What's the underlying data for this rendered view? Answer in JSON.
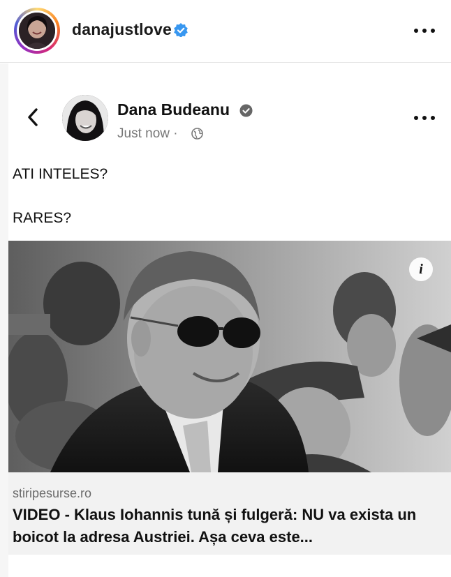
{
  "instagram": {
    "username": "danajustlove",
    "verified": true,
    "more_icon": "more-horizontal-icon",
    "ring_colors": [
      "#feda75",
      "#fa7e1e",
      "#d62976",
      "#962fbf",
      "#4f5bd5"
    ],
    "verified_color": "#3897f0"
  },
  "facebook_post": {
    "author": "Dana Budeanu",
    "author_verified": true,
    "time": "Just now",
    "separator": "·",
    "privacy_icon": "globe-icon",
    "back_icon": "chevron-left-icon",
    "more_icon": "more-horizontal-icon",
    "text_lines": [
      "ATI INTELES?",
      "RARES?"
    ],
    "link": {
      "domain": "stiripesurse.ro",
      "title": "VIDEO - Klaus Iohannis tună și fulgeră: NU va exista un boicot la adresa Austriei. Așa ceva este...",
      "info_label": "i",
      "image": "grayscale-photo-man-sunglasses-suit"
    }
  }
}
